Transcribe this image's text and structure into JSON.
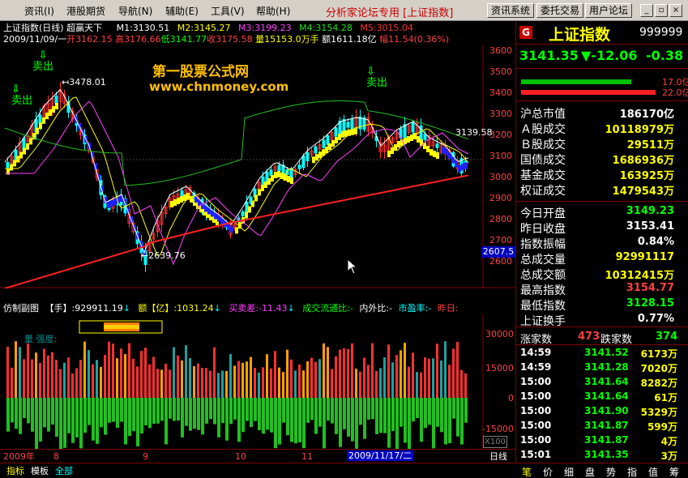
{
  "menu": {
    "items": [
      "资讯(I)",
      "港股期货",
      "导航(N)",
      "辅助(E)",
      "工具(V)",
      "帮助(H)"
    ],
    "title": "分析家论坛专用 [上证指数]",
    "buttons": [
      "资讯系统",
      "委托交易",
      "用户论坛"
    ],
    "window_icons": [
      "minimize-icon",
      "restore-icon",
      "close-icon"
    ]
  },
  "chart_header": {
    "name": "上证指数(日线) 超赢天下",
    "ma1": "M1:3130.51",
    "ma2": "M2:3145.27",
    "ma3": "M3:3199.23",
    "ma4": "M4:3154.28",
    "ma5": "M5:3015.04",
    "date": "2009/11/09/一",
    "open": "开3162.15",
    "high": "高3176.66",
    "low": "低3141.77",
    "close": "收3175.58",
    "volume": "量15153.0万手",
    "amount": "额1611.18亿",
    "change": "幅11.54(0.36%)"
  },
  "watermark": {
    "line1": "第一股票公式网",
    "line2": "www.chnmoney.com"
  },
  "annotations": {
    "sell1": "卖出",
    "sell2": "卖出",
    "sell3": "卖出",
    "high_mark": "3478.01",
    "low_mark": "2639.76",
    "last_mark": "3139.58",
    "price_tag": "2607.5"
  },
  "indicator_header": {
    "name": "仿制副图",
    "hand": "【手】:929911.19",
    "amount": "额【亿】:1031.24",
    "buysell": "买卖差:-11.43",
    "flow": "成交流通比:-",
    "inout": "内外比:-",
    "pe": "市盈率:-",
    "yesterday": "昨日:",
    "faded": "量       强度:"
  },
  "x_axis": {
    "labels": [
      "2009年",
      "8",
      "9",
      "10",
      "11"
    ],
    "cursor_date": "2009/11/17/二",
    "period": "日线",
    "scale_btn": "X100"
  },
  "y_axis_main": [
    "3600",
    "3500",
    "3400",
    "3300",
    "3200",
    "3100",
    "3000",
    "2900",
    "2800",
    "2700",
    "2600"
  ],
  "y_axis_ind": [
    "30000",
    "15000",
    "0",
    "-15000"
  ],
  "bottom_tabs": [
    "指标",
    "模板",
    "全部"
  ],
  "right_panel": {
    "flag": "G",
    "name": "上证指数",
    "code": "999999",
    "price": "3141.35",
    "change": "▼-12.06",
    "change_pct": "-0.38",
    "bar1_value": "17.0亿",
    "bar2_value": "22.0亿",
    "stats": [
      {
        "label": "沪总市值",
        "value": "186170亿",
        "color": "#ffffff"
      },
      {
        "label": "Ａ股成交",
        "value": "10118979万",
        "color": "#ffff00"
      },
      {
        "label": "Ｂ股成交",
        "value": "29511万",
        "color": "#ffff00"
      },
      {
        "label": "国债成交",
        "value": "1686936万",
        "color": "#ffff00"
      },
      {
        "label": "基金成交",
        "value": "163925万",
        "color": "#ffff00"
      },
      {
        "label": "权证成交",
        "value": "1479543万",
        "color": "#ffff00"
      }
    ],
    "quotes": [
      {
        "label": "今日开盘",
        "value": "3149.23",
        "color": "#00ff00"
      },
      {
        "label": "昨日收盘",
        "value": "3153.41",
        "color": "#ffffff"
      },
      {
        "label": "指数振幅",
        "value": "0.84%",
        "color": "#ffffff"
      },
      {
        "label": "总成交量",
        "value": "92991117",
        "color": "#ffff00"
      },
      {
        "label": "总成交额",
        "value": "10312415万",
        "color": "#ffff00"
      },
      {
        "label": "最高指数",
        "value": "3154.77",
        "color": "#ff4040"
      },
      {
        "label": "最低指数",
        "value": "3128.15",
        "color": "#00ff00"
      },
      {
        "label": "上证换手",
        "value": "0.77%",
        "color": "#ffffff"
      }
    ],
    "updown_label1": "涨家数",
    "updown_val1": "473",
    "updown_label2": "跌家数",
    "updown_val2": "374",
    "ticks": [
      {
        "time": "14:59",
        "price": "3141.52",
        "vol": "6173万"
      },
      {
        "time": "14:59",
        "price": "3141.28",
        "vol": "7020万"
      },
      {
        "time": "15:00",
        "price": "3141.64",
        "vol": "8282万"
      },
      {
        "time": "15:00",
        "price": "3141.64",
        "vol": "61万"
      },
      {
        "time": "15:00",
        "price": "3141.90",
        "vol": "5329万"
      },
      {
        "time": "15:00",
        "price": "3141.87",
        "vol": "599万"
      },
      {
        "time": "15:00",
        "price": "3141.87",
        "vol": "4万"
      },
      {
        "time": "15:01",
        "price": "3141.35",
        "vol": "3万"
      }
    ],
    "tabs": [
      "笔",
      "价",
      "细",
      "盘",
      "势",
      "指",
      "值",
      "筹"
    ]
  },
  "colors": {
    "up": "#ff3030",
    "down": "#00ffff",
    "ma_red": "#ff2020",
    "ma_green": "#20c020",
    "ma_magenta": "#ff40ff",
    "ma_white": "#ffffff",
    "ma_yellow": "#ffff00",
    "band_blue": "#2020ff",
    "band_yellow": "#ffff00"
  }
}
